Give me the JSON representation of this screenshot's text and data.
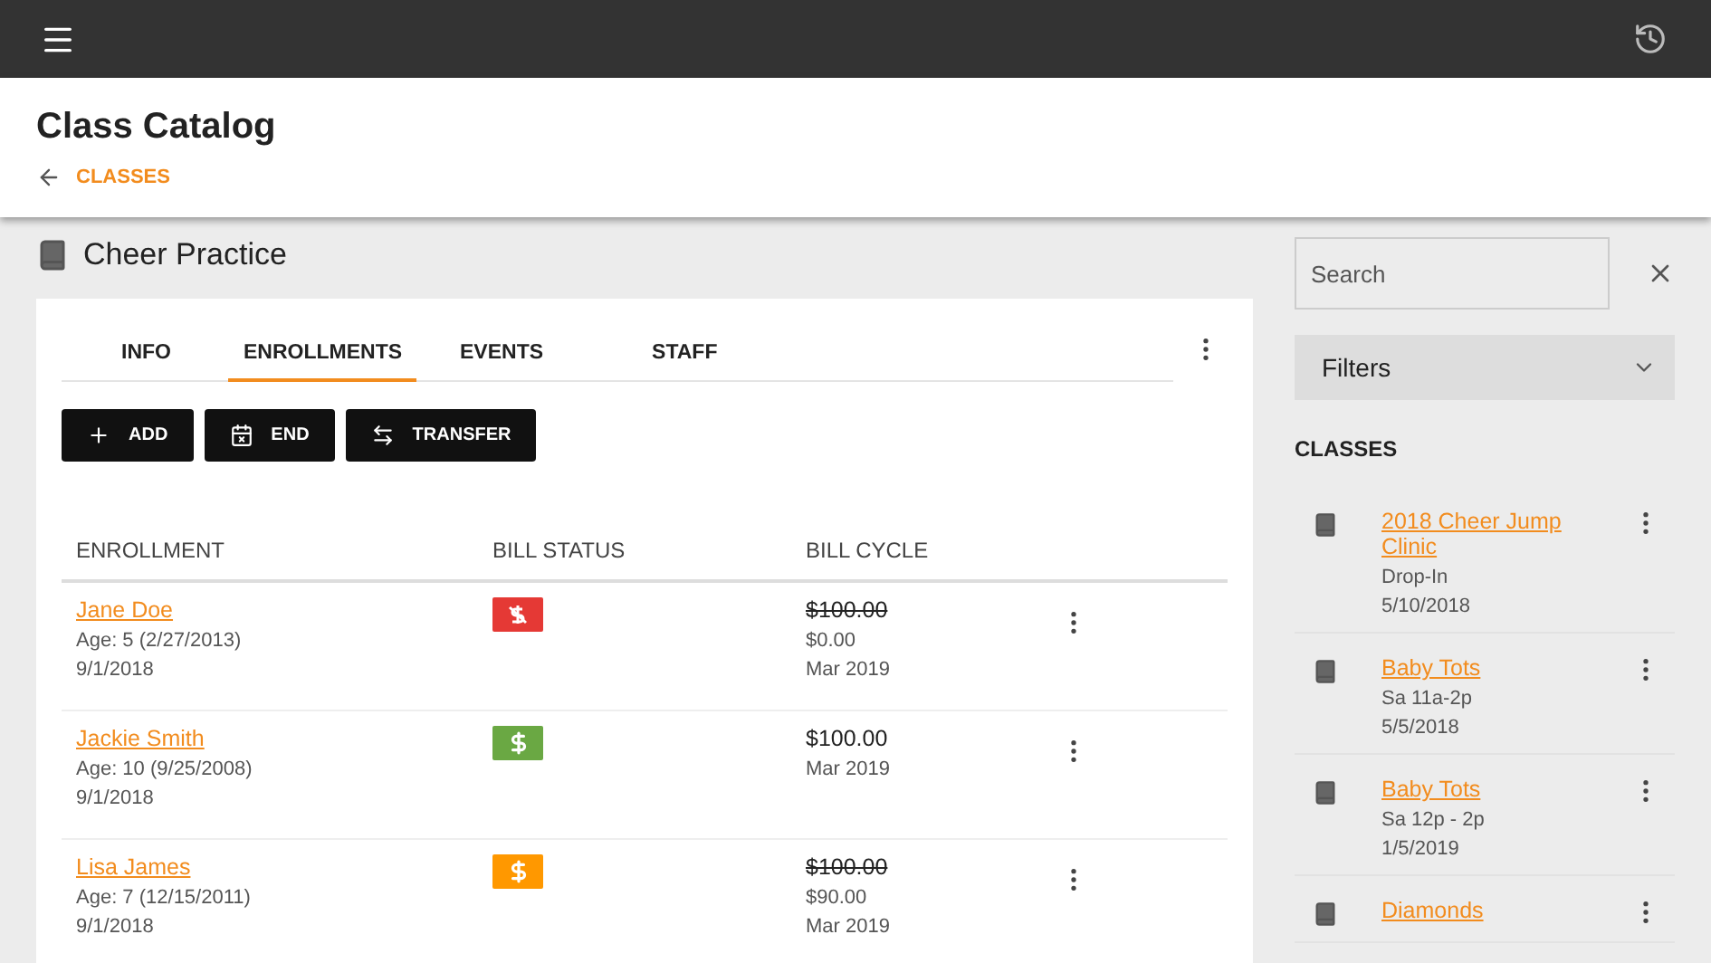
{
  "header": {
    "title": "Class Catalog",
    "breadcrumb": "CLASSES"
  },
  "class_title": "Cheer Practice",
  "tabs": [
    {
      "label": "INFO",
      "selected": false
    },
    {
      "label": "ENROLLMENTS",
      "selected": true
    },
    {
      "label": "EVENTS",
      "selected": false
    },
    {
      "label": "STAFF",
      "selected": false
    }
  ],
  "actions": [
    {
      "kind": "add",
      "label": "ADD"
    },
    {
      "kind": "end",
      "label": "END"
    },
    {
      "kind": "transfer",
      "label": "TRANSFER"
    }
  ],
  "table": {
    "columns": [
      "ENROLLMENT",
      "BILL STATUS",
      "BILL CYCLE"
    ],
    "rows": [
      {
        "name": "Jane Doe",
        "age": "Age: 5 (2/27/2013)",
        "date": "9/1/2018",
        "status": {
          "kind": "waived",
          "color": "#e53935"
        },
        "cycle": [
          {
            "text": "$100.00",
            "struck": true
          },
          {
            "text": "$0.00",
            "struck": false
          },
          {
            "text": "Mar 2019",
            "struck": false
          }
        ]
      },
      {
        "name": "Jackie Smith",
        "age": "Age: 10 (9/25/2008)",
        "date": "9/1/2018",
        "status": {
          "kind": "paid",
          "color": "#6aa843"
        },
        "cycle": [
          {
            "text": "$100.00",
            "struck": false,
            "main": true
          },
          {
            "text": "Mar 2019",
            "struck": false
          }
        ]
      },
      {
        "name": "Lisa James",
        "age": "Age: 7 (12/15/2011)",
        "date": "9/1/2018",
        "status": {
          "kind": "paid",
          "color": "#ff9800"
        },
        "cycle": [
          {
            "text": "$100.00",
            "struck": true
          },
          {
            "text": "$90.00",
            "struck": false
          },
          {
            "text": "Mar 2019",
            "struck": false
          }
        ]
      }
    ]
  },
  "sidebar": {
    "search": {
      "placeholder": "Search"
    },
    "filters": "Filters",
    "heading": "CLASSES",
    "items": [
      {
        "name": "2018 Cheer Jump Clinic",
        "lines": [
          "Drop-In",
          "5/10/2018"
        ]
      },
      {
        "name": "Baby Tots",
        "lines": [
          "Sa 11a-2p",
          "5/5/2018"
        ]
      },
      {
        "name": "Baby Tots",
        "lines": [
          "Sa 12p - 2p",
          "1/5/2019"
        ]
      },
      {
        "name": "Diamonds"
      }
    ]
  }
}
